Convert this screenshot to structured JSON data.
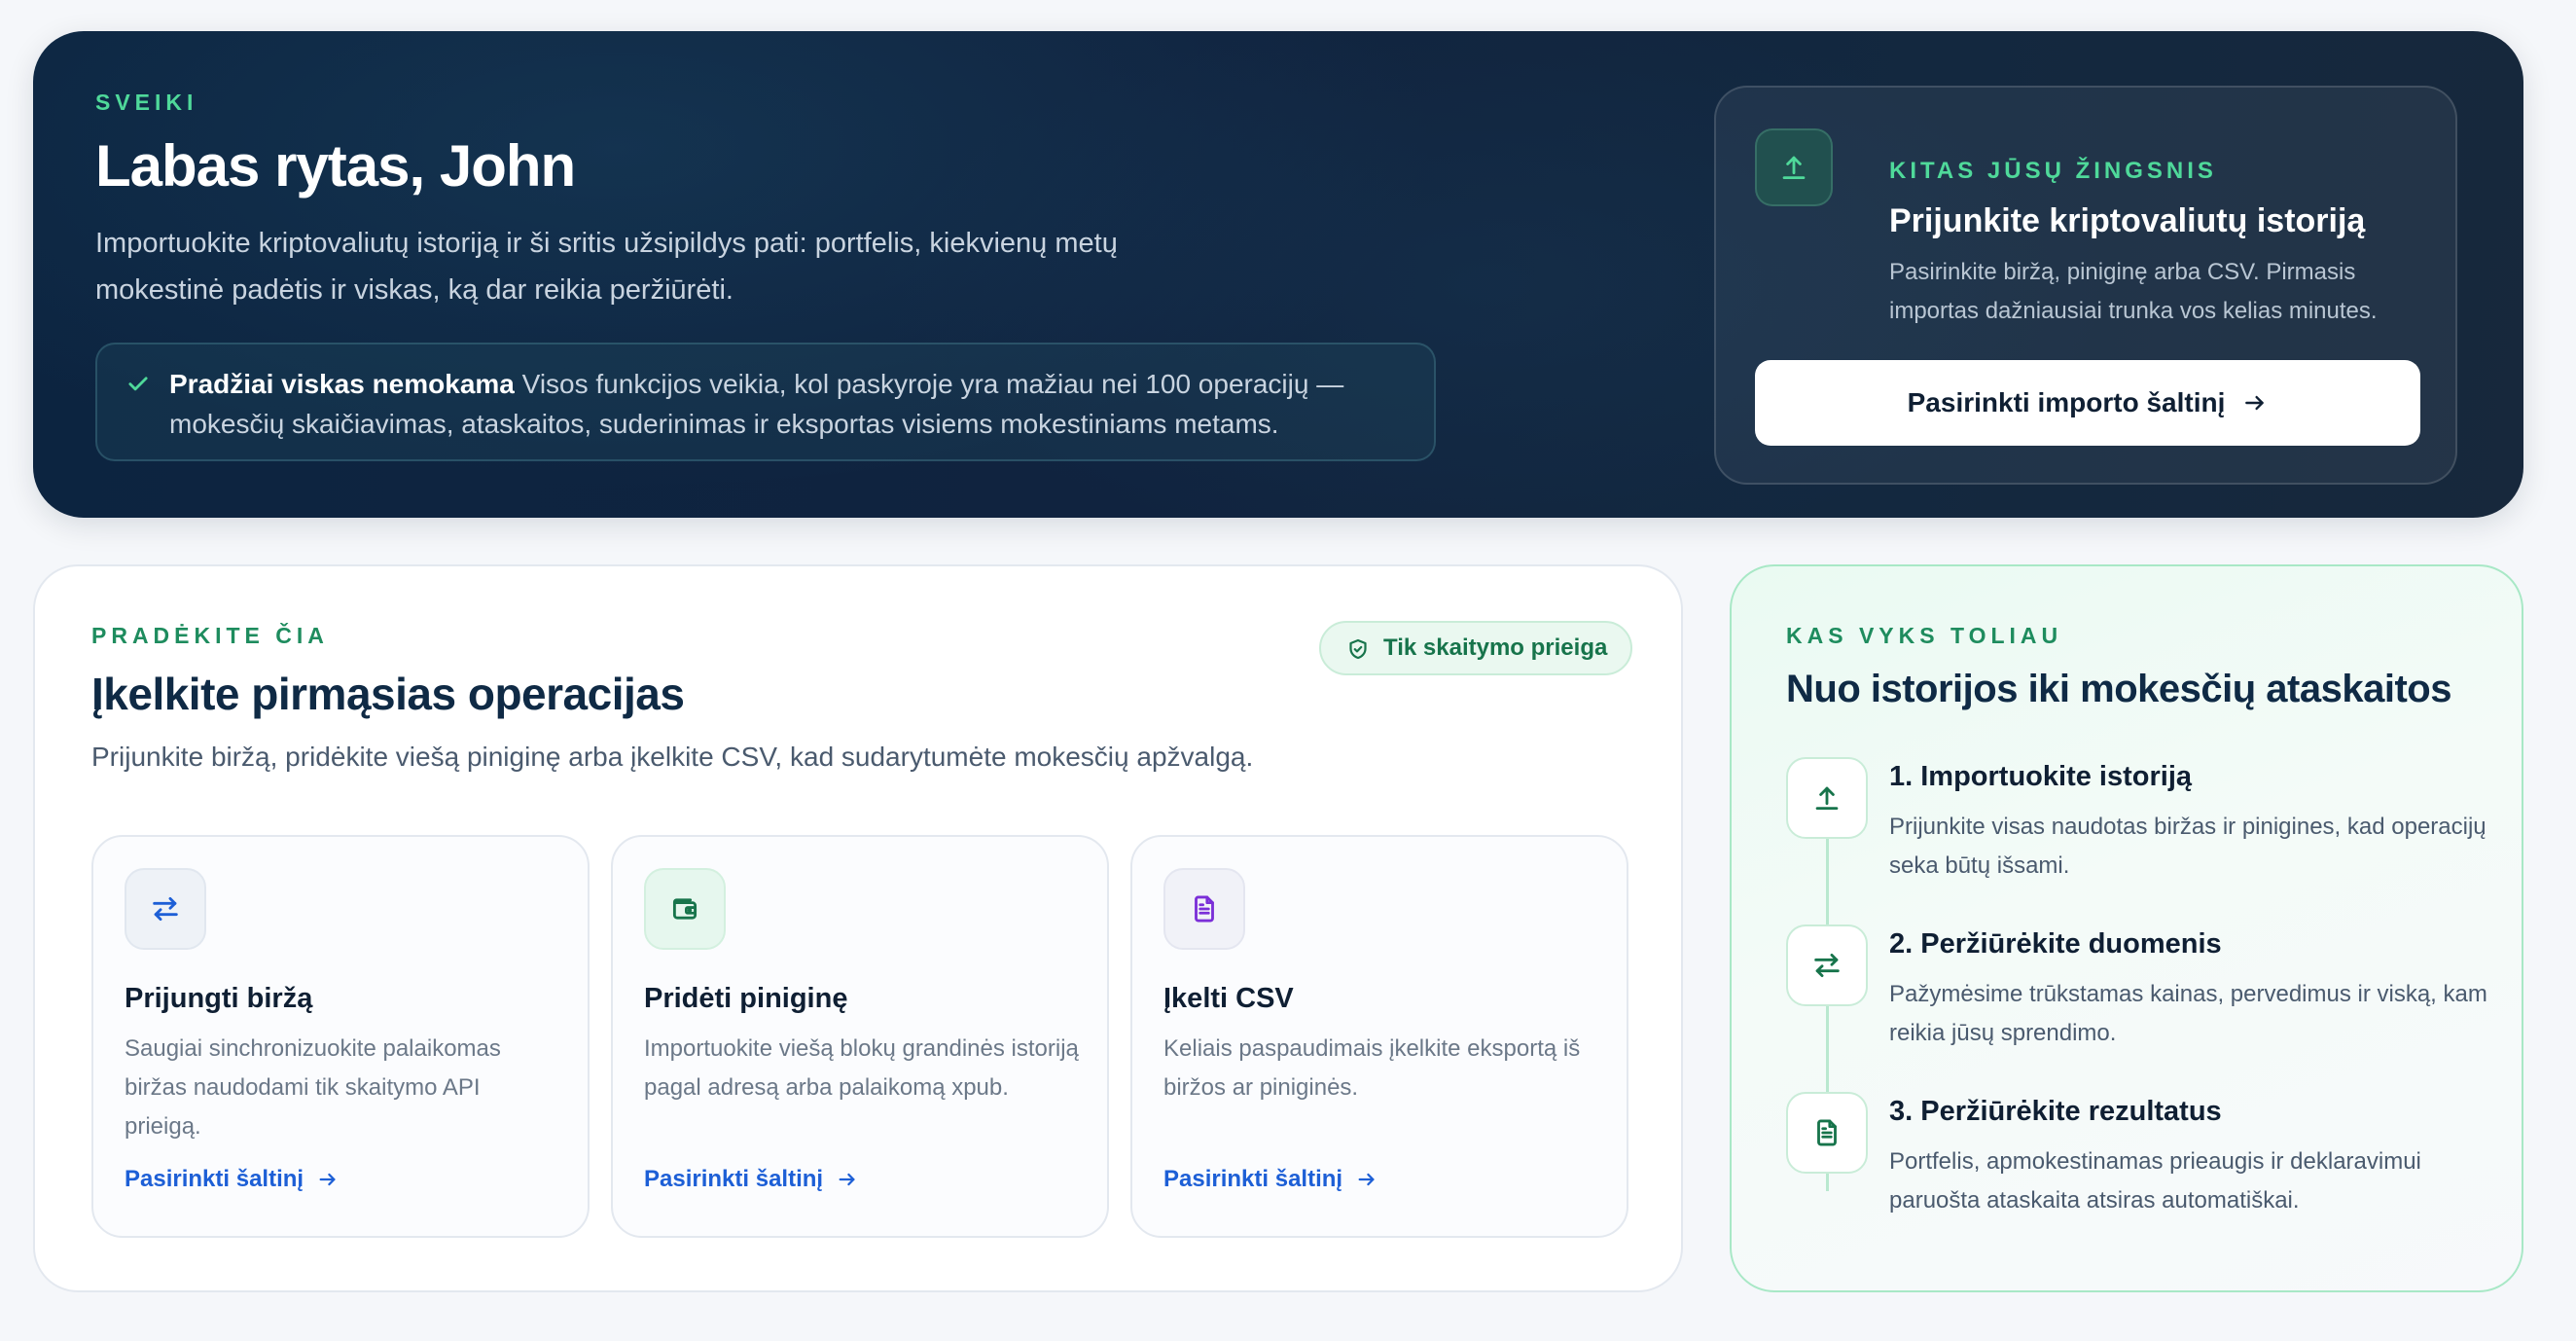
{
  "hero": {
    "eyebrow": "SVEIKI",
    "greeting": "Labas rytas, John",
    "lead": "Importuokite kriptovaliutų istoriją ir ši sritis užsipildys pati: portfelis, kiekvienų metų mokestinė padėtis ir viskas, ką dar reikia peržiūrėti.",
    "notice_strong": "Pradžiai viskas nemokama",
    "notice_text": " Visos funkcijos veikia, kol paskyroje yra mažiau nei 100 operacijų — mokesčių skaičiavimas, ataskaitos, suderinimas ir eksportas visiems mokestiniams metams.",
    "next_step": {
      "eyebrow": "KITAS JŪSŲ ŽINGSNIS",
      "title": "Prijunkite kriptovaliutų istoriją",
      "description": "Pasirinkite biržą, piniginę arba CSV. Pirmasis importas dažniausiai trunka vos kelias minutes.",
      "cta": "Pasirinkti importo šaltinį"
    }
  },
  "start": {
    "eyebrow": "PRADĖKITE ČIA",
    "title": "Įkelkite pirmąsias operacijas",
    "subtitle": "Prijunkite biržą, pridėkite viešą piniginę arba įkelkite CSV, kad sudarytumėte mokesčių apžvalgą.",
    "badge": "Tik skaitymo prieiga",
    "sources": [
      {
        "icon": "exchange-arrows-icon",
        "title": "Prijungti biržą",
        "description": "Saugiai sinchronizuokite palaikomas biržas naudodami tik skaitymo API prieigą.",
        "link": "Pasirinkti šaltinį"
      },
      {
        "icon": "wallet-icon",
        "title": "Pridėti piniginę",
        "description": "Importuokite viešą blokų grandinės istoriją pagal adresą arba palaikomą xpub.",
        "link": "Pasirinkti šaltinį"
      },
      {
        "icon": "document-icon",
        "title": "Įkelti CSV",
        "description": "Keliais paspaudimais įkelkite eksportą iš biržos ar piniginės.",
        "link": "Pasirinkti šaltinį"
      }
    ]
  },
  "flow": {
    "eyebrow": "KAS VYKS TOLIAU",
    "title": "Nuo istorijos iki mokesčių ataskaitos",
    "steps": [
      {
        "icon": "upload-icon",
        "title": "1. Importuokite istoriją",
        "description": "Prijunkite visas naudotas biržas ir pinigines, kad operacijų seka būtų išsami."
      },
      {
        "icon": "exchange-arrows-icon",
        "title": "2. Peržiūrėkite duomenis",
        "description": "Pažymėsime trūkstamas kainas, pervedimus ir viską, kam reikia jūsų sprendimo."
      },
      {
        "icon": "document-icon",
        "title": "3. Peržiūrėkite rezultatus",
        "description": "Portfelis, apmokestinamas prieaugis ir deklaravimui paruošta ataskaita atsiras automatiškai."
      }
    ]
  },
  "colors": {
    "accent_green": "#4fd99a",
    "link_blue": "#1d5fd6",
    "hero_bg": "#10233f"
  }
}
